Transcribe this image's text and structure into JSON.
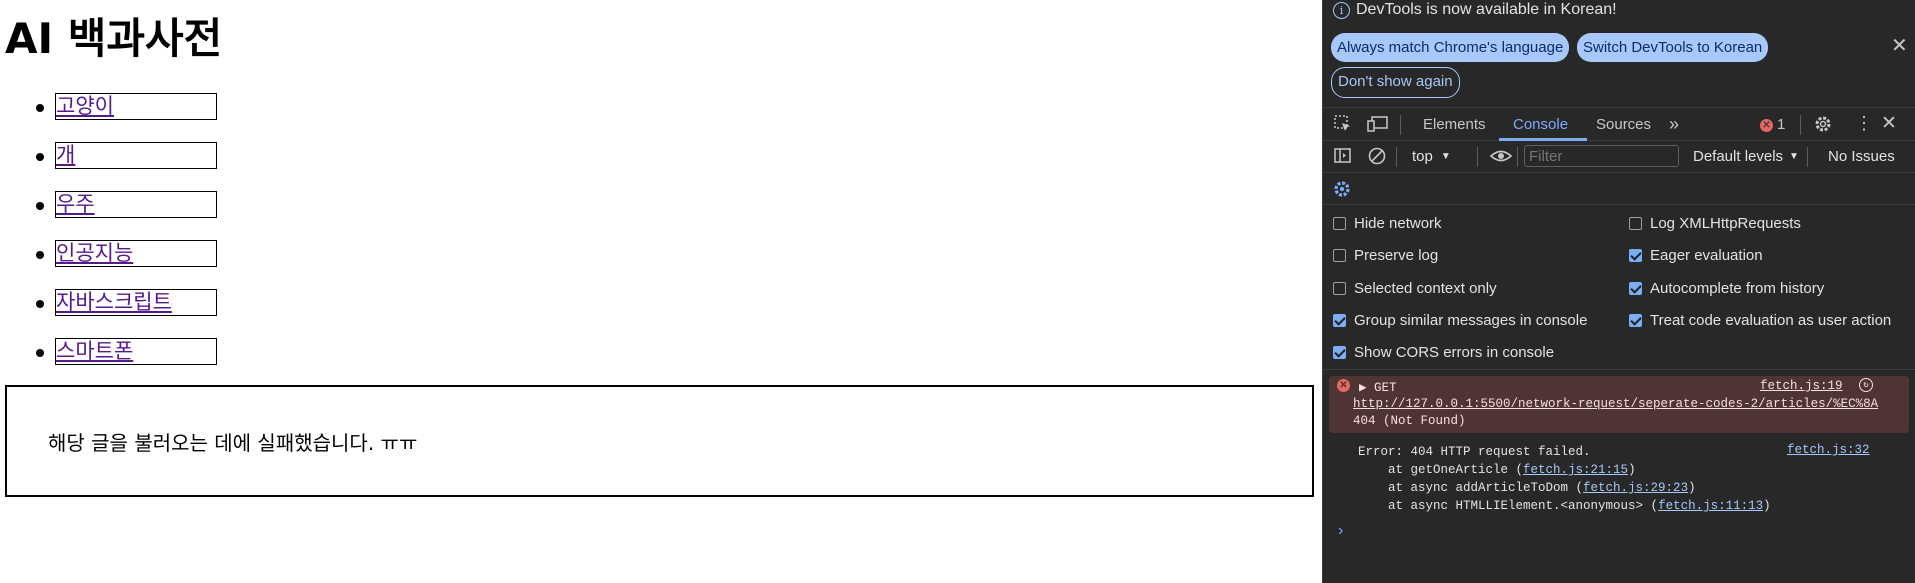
{
  "page": {
    "title": "AI 백과사전",
    "topics": [
      "고양이",
      "개",
      "우주",
      "인공지능",
      "자바스크립트",
      "스마트폰"
    ],
    "article_message": "해당 글을 불러오는 데에 실패했습니다. ㅠㅠ"
  },
  "devtools": {
    "banner": {
      "info_text": "DevTools is now available in Korean!",
      "btn_match": "Always match Chrome's language",
      "btn_switch": "Switch DevTools to Korean",
      "btn_dismiss": "Don't show again"
    },
    "tabs": {
      "elements": "Elements",
      "console": "Console",
      "sources": "Sources",
      "more": "»",
      "error_count": "1"
    },
    "toolbar": {
      "context": "top",
      "filter_placeholder": "Filter",
      "levels": "Default levels",
      "issues": "No Issues"
    },
    "settings": {
      "hide_network": "Hide network",
      "log_xhr": "Log XMLHttpRequests",
      "preserve_log": "Preserve log",
      "eager_eval": "Eager evaluation",
      "selected_context": "Selected context only",
      "autocomplete": "Autocomplete from history",
      "group_similar": "Group similar messages in console",
      "treat_eval": "Treat code evaluation as user action",
      "show_cors": "Show CORS errors in console"
    },
    "error_request": {
      "method": "GET",
      "source": "fetch.js:19",
      "url": "http://127.0.0.1:5500/network-request/seperate-codes-2/articles/%EC%8A",
      "status": "404 (Not Found)"
    },
    "error_trace": {
      "message": "Error: 404 HTTP request failed.",
      "source": "fetch.js:32",
      "frame1_prefix": "    at getOneArticle (",
      "frame1_link": "fetch.js:21:15",
      "frame2_prefix": "    at async addArticleToDom (",
      "frame2_link": "fetch.js:29:23",
      "frame3_prefix": "    at async HTMLLIElement.<anonymous> (",
      "frame3_link": "fetch.js:11:13",
      "close_paren": ")"
    },
    "colors": {
      "accent": "#7cacf8",
      "panel_bg": "#282828",
      "error_bg": "#4e3534"
    }
  }
}
